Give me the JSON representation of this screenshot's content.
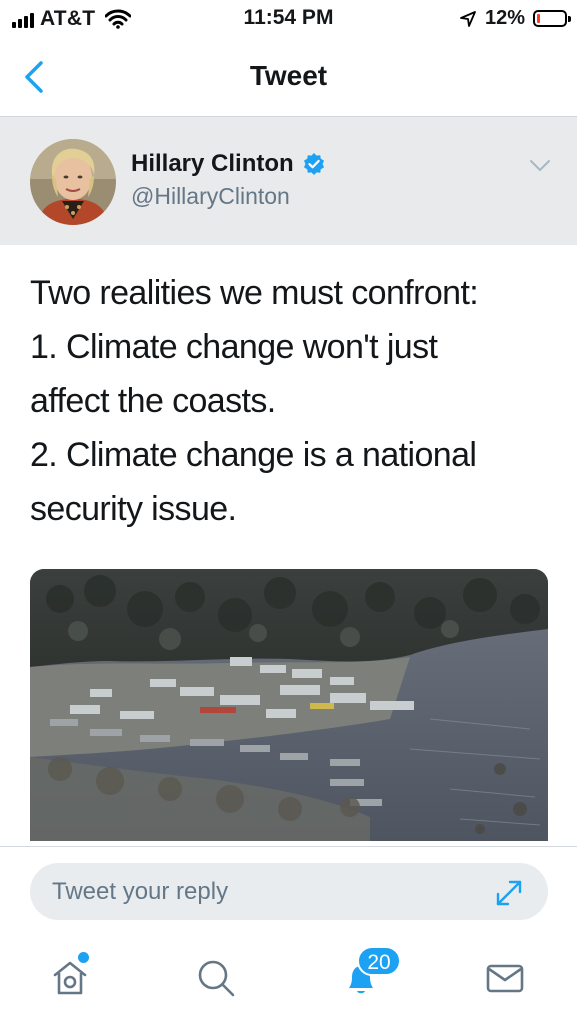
{
  "status_bar": {
    "carrier": "AT&T",
    "time": "11:54 PM",
    "battery_percent": "12%",
    "battery_level": 0.12,
    "icons": [
      "signal-icon",
      "wifi-icon",
      "location-arrow-icon",
      "battery-icon"
    ]
  },
  "nav": {
    "title": "Tweet",
    "back_icon": "chevron-left-icon"
  },
  "author": {
    "name": "Hillary Clinton",
    "handle": "@HillaryClinton",
    "verified_icon": "verified-badge-icon",
    "menu_icon": "chevron-down-icon"
  },
  "tweet": {
    "lines": [
      "Two realities we must confront:",
      "1. Climate change won't just",
      "affect the coasts.",
      "2. Climate change is a national",
      "security issue."
    ],
    "photo_description": "aerial flood photo"
  },
  "reply": {
    "placeholder": "Tweet your reply",
    "expand_icon": "expand-arrows-icon"
  },
  "tabs": [
    {
      "name": "home-icon",
      "has_dot": true
    },
    {
      "name": "search-icon"
    },
    {
      "name": "notifications-icon",
      "badge": "20"
    },
    {
      "name": "messages-icon"
    }
  ],
  "colors": {
    "accent": "#1da1f2",
    "header_bg": "#e9eaec",
    "battery_low": "#ff3b30",
    "secondary_text": "#657786"
  }
}
